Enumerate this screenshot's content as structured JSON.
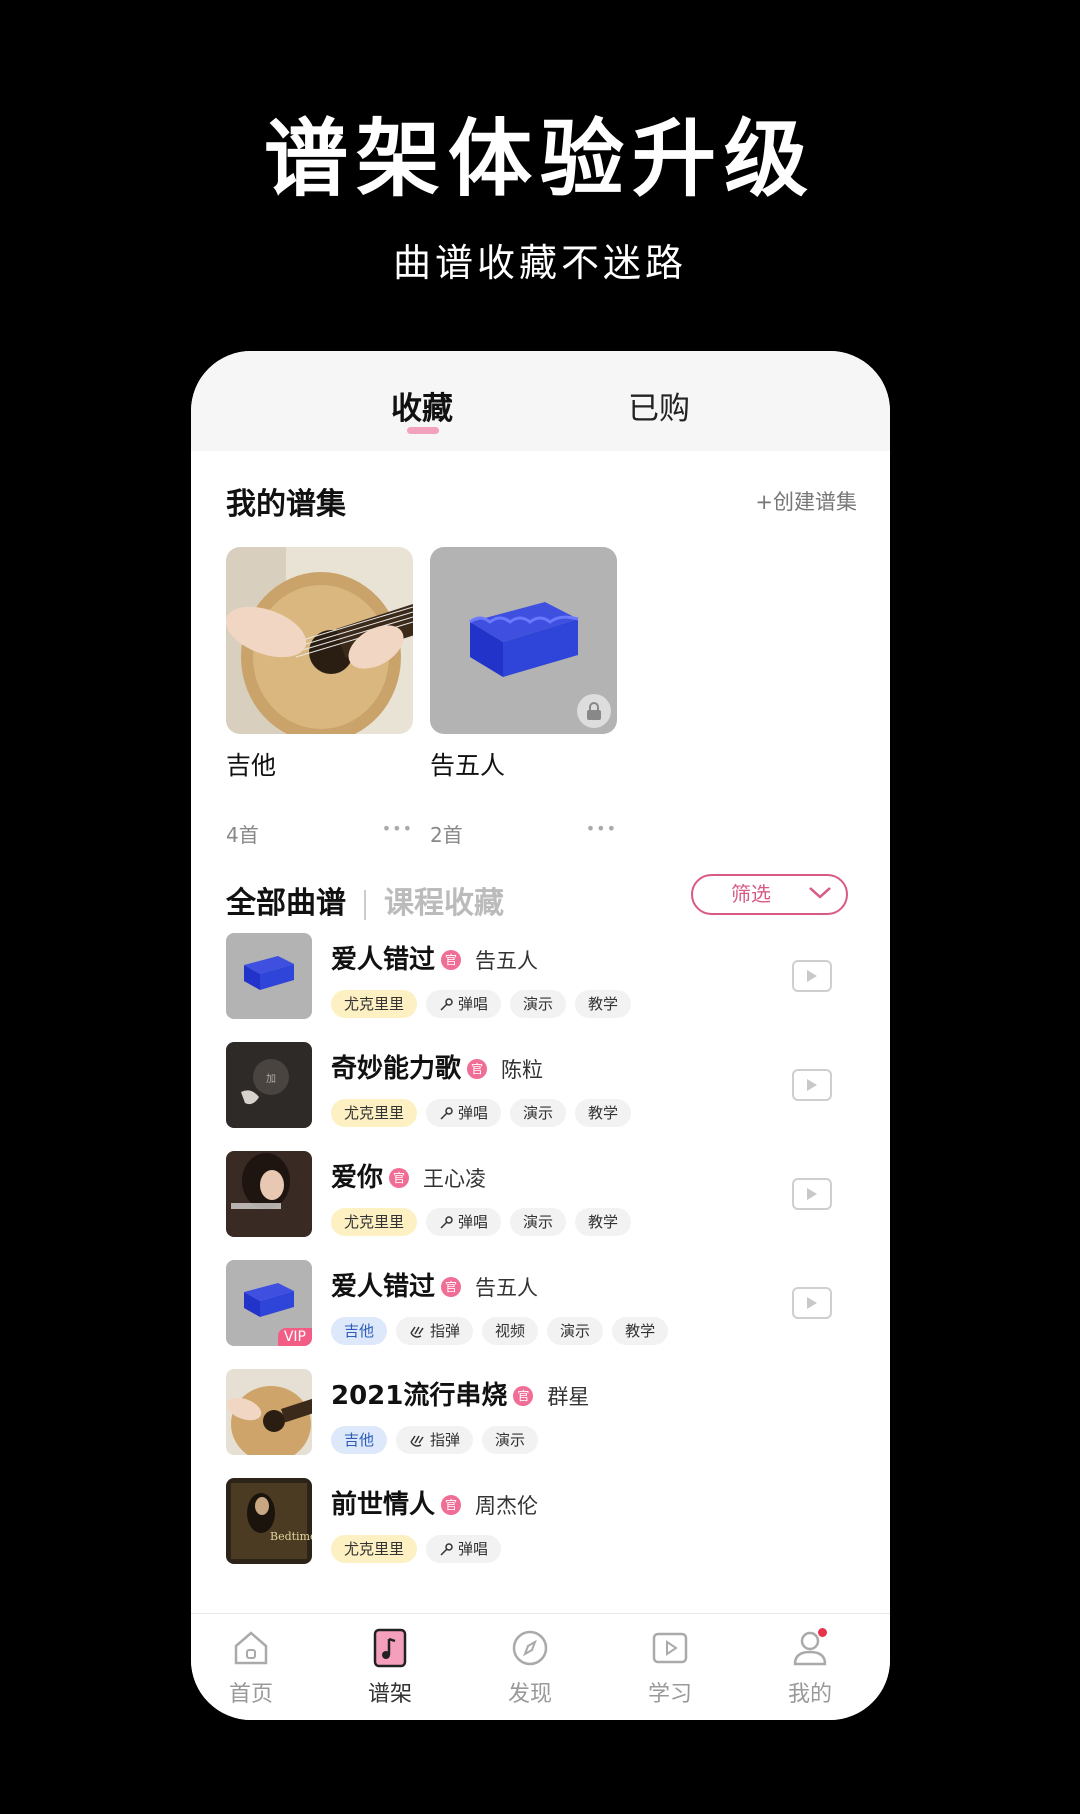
{
  "promo": {
    "title": "谱架体验升级",
    "subtitle": "曲谱收藏不迷路"
  },
  "tabs": [
    {
      "label": "收藏",
      "active": true
    },
    {
      "label": "已购",
      "active": false
    }
  ],
  "collections_section": {
    "title": "我的谱集",
    "create_label": "+创建谱集",
    "items": [
      {
        "name": "吉他",
        "count": "4首",
        "more": "•••"
      },
      {
        "name": "告五人",
        "count": "2首",
        "more": "•••"
      }
    ]
  },
  "list_tabs": {
    "all": "全部曲谱",
    "course": "课程收藏",
    "filter": "筛选"
  },
  "songs": [
    {
      "title": "爱人错过",
      "badge": "官",
      "artist": "告五人",
      "tags": [
        "尤克里里",
        "弹唱",
        "演示",
        "教学"
      ]
    },
    {
      "title": "奇妙能力歌",
      "badge": "官",
      "artist": "陈粒",
      "tags": [
        "尤克里里",
        "弹唱",
        "演示",
        "教学"
      ]
    },
    {
      "title": "爱你",
      "badge": "官",
      "artist": "王心凌",
      "tags": [
        "尤克里里",
        "弹唱",
        "演示",
        "教学"
      ]
    },
    {
      "title": "爱人错过",
      "badge": "官",
      "artist": "告五人",
      "vip": "VIP",
      "tags": [
        "吉他",
        "指弹",
        "视频",
        "演示",
        "教学"
      ]
    },
    {
      "title": "2021流行串烧",
      "badge": "官",
      "artist": "群星",
      "tags": [
        "吉他",
        "指弹",
        "演示"
      ]
    },
    {
      "title": "前世情人",
      "badge": "官",
      "artist": "周杰伦",
      "tags": [
        "尤克里里",
        "弹唱"
      ]
    }
  ],
  "nav": [
    {
      "label": "首页",
      "icon": "home-icon"
    },
    {
      "label": "谱架",
      "icon": "music-stand-icon",
      "active": true
    },
    {
      "label": "发现",
      "icon": "compass-icon"
    },
    {
      "label": "学习",
      "icon": "play-video-icon"
    },
    {
      "label": "我的",
      "icon": "user-icon"
    }
  ],
  "colors": {
    "accent": "#d95a87",
    "badge": "#f06d95",
    "ukulele_tag": "#fdf0c2",
    "guitar_tag": "#dde8fb"
  }
}
